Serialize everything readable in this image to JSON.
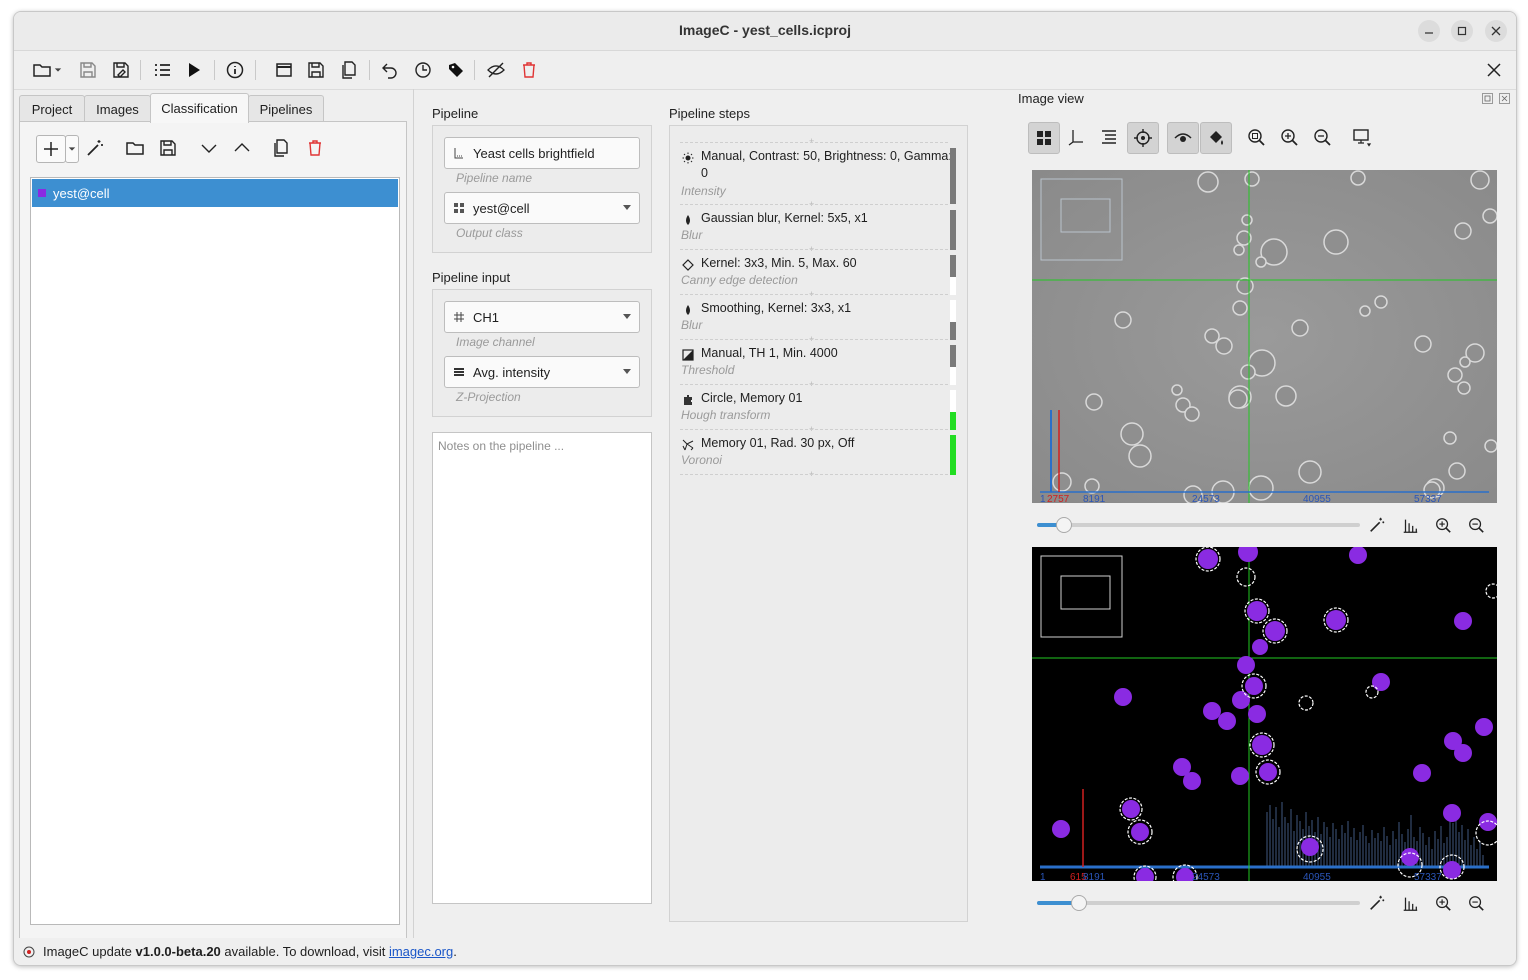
{
  "window": {
    "title": "ImageC - yest_cells.icproj"
  },
  "toolbar": {
    "icons": [
      "folder-open-icon",
      "save-icon",
      "save-as-icon",
      "list-icon",
      "run-icon",
      "info-icon",
      "window-icon",
      "save-template-icon",
      "copy-icon",
      "undo-icon",
      "history-icon",
      "tag-icon",
      "hide-icon",
      "delete-icon",
      "close-icon"
    ]
  },
  "tabs": [
    {
      "label": "Project"
    },
    {
      "label": "Images"
    },
    {
      "label": "Classification",
      "active": true
    },
    {
      "label": "Pipelines"
    }
  ],
  "classes": [
    {
      "name": "yest@cell",
      "color": "#8a2be2",
      "selected": true
    }
  ],
  "pipeline": {
    "label": "Pipeline",
    "name_value": "Yeast cells brightfield",
    "name_hint": "Pipeline name",
    "output_class_value": "yest@cell",
    "output_class_hint": "Output class"
  },
  "pipeline_input": {
    "label": "Pipeline input",
    "channel_value": "CH1",
    "channel_hint": "Image channel",
    "projection_value": "Avg. intensity",
    "projection_hint": "Z-Projection"
  },
  "notes": {
    "placeholder": "Notes on the pipeline ..."
  },
  "steps": {
    "label": "Pipeline steps",
    "items": [
      {
        "title": "Manual, Contrast: 50, Brightness: 0, Gamma: 0",
        "subtitle": "Intensity",
        "icon": "brightness-icon"
      },
      {
        "title": "Gaussian blur, Kernel: 5x5, x1",
        "subtitle": "Blur",
        "icon": "drop-icon"
      },
      {
        "title": "Kernel: 3x3, Min. 5, Max. 60",
        "subtitle": "Canny edge detection",
        "icon": "diamond-icon"
      },
      {
        "title": "Smoothing, Kernel: 3x3, x1",
        "subtitle": "Blur",
        "icon": "drop-icon"
      },
      {
        "title": "Manual, TH 1, Min. 4000",
        "subtitle": "Threshold",
        "icon": "threshold-icon"
      },
      {
        "title": "Circle, Memory 01",
        "subtitle": "Hough transform",
        "icon": "puzzle-icon"
      },
      {
        "title": "Memory 01, Rad. 30 px, Off",
        "subtitle": "Voronoi",
        "icon": "voronoi-icon"
      }
    ]
  },
  "image_view": {
    "title": "Image view",
    "top_histogram": {
      "min": "1",
      "marker": "2757",
      "ticks": [
        "8191",
        "24573",
        "40955",
        "57337"
      ]
    },
    "bottom_histogram": {
      "min": "1",
      "marker": "615",
      "ticks": [
        "8191",
        "24573",
        "40955",
        "57337"
      ]
    },
    "top_slider_value": 0.06,
    "bottom_slider_value": 0.11
  },
  "status": {
    "prefix": "ImageC update ",
    "version": "v1.0.0-beta.20",
    "middle": " available. To download, visit ",
    "link": "imagec.org",
    "suffix": "."
  }
}
